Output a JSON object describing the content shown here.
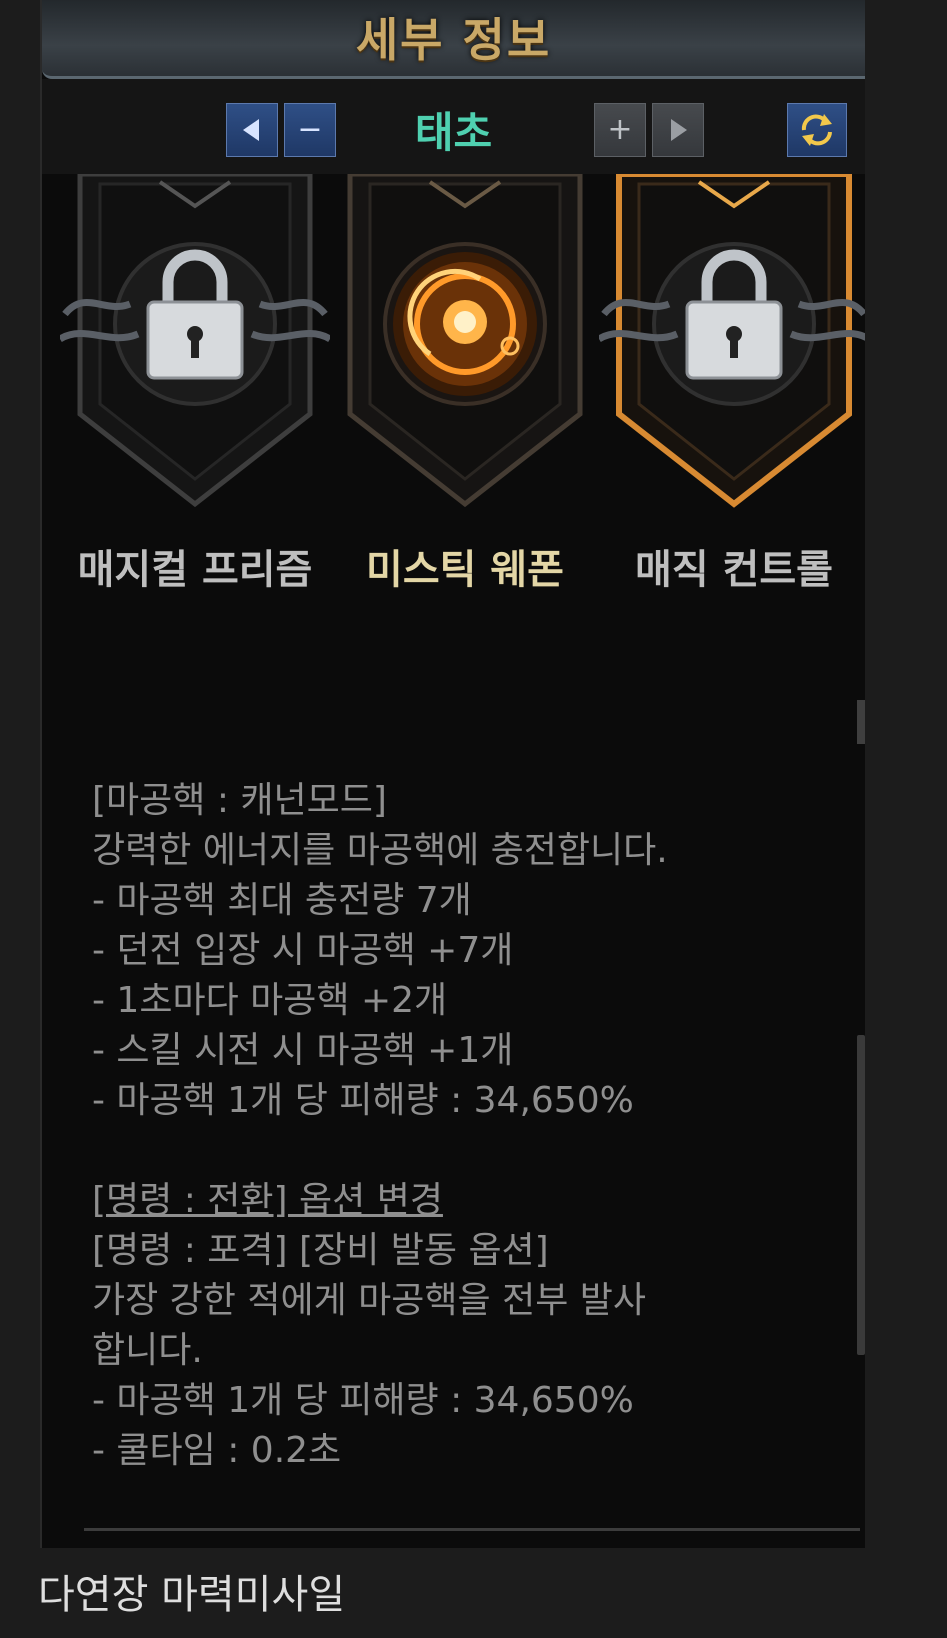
{
  "window": {
    "title": "세부 정보"
  },
  "nav": {
    "prev_icon": "left-arrow-icon",
    "minus_label": "−",
    "stage_name": "태초",
    "plus_label": "+",
    "next_icon": "right-arrow-icon",
    "refresh_icon": "refresh-icon"
  },
  "emblems": [
    {
      "name": "매지컬 프리즘",
      "icon": "lock-icon",
      "state": "locked"
    },
    {
      "name": "미스틱 웨폰",
      "icon": "energy-orb-icon",
      "state": "selected"
    },
    {
      "name": "매직 컨트롤",
      "icon": "lock-icon",
      "state": "locked-highlighted"
    }
  ],
  "description": {
    "line1": "[마공핵 : 캐넌모드]",
    "line2": "강력한 에너지를 마공핵에 충전합니다.",
    "line3": "- 마공핵 최대 충전량 7개",
    "line4": "- 던전 입장 시 마공핵 +7개",
    "line5": "- 1초마다 마공핵 +2개",
    "line6": "- 스킬 시전 시 마공핵 +1개",
    "line7": "- 마공핵 1개 당 피해량 : 34,650%",
    "link": "[명령 : 전환] 옵션 변경",
    "line8": "[명령 : 포격] [장비 발동 옵션]",
    "line9": "가장 강한 적에게 마공핵을 전부 발사",
    "line10": "합니다.",
    "line11": "- 마공핵 1개 당 피해량 : 34,650%",
    "line12": "- 쿨타임 : 0.2초"
  },
  "caption": "다연장 마력미사일",
  "colors": {
    "title_gold": "#c9a867",
    "stage_teal": "#4fd0b0",
    "active_label": "#e3d6a6",
    "orb_orange": "#ff9a2a",
    "button_blue": "#2f4f86"
  }
}
